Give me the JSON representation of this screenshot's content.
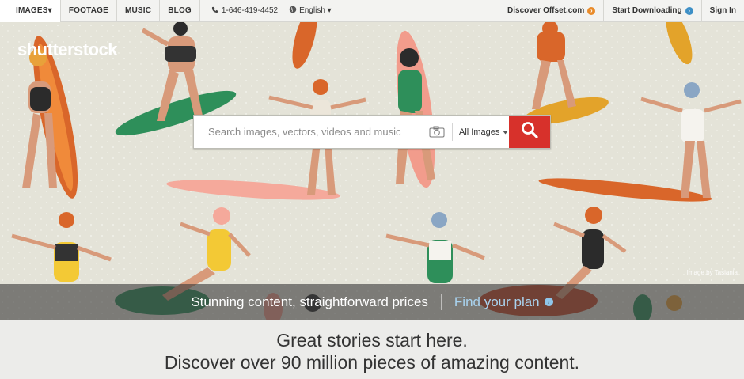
{
  "nav": {
    "tabs": [
      {
        "label": "IMAGES▾"
      },
      {
        "label": "FOOTAGE"
      },
      {
        "label": "MUSIC"
      },
      {
        "label": "BLOG"
      }
    ],
    "phone": "1-646-419-4452",
    "language": "English ▾",
    "right": {
      "offset": "Discover Offset.com",
      "start": "Start Downloading",
      "signin": "Sign In"
    }
  },
  "hero": {
    "logo": "shutterstock",
    "credit": "Image by Tasiania",
    "search": {
      "placeholder": "Search images, vectors, videos and music",
      "filter": "All Images"
    },
    "banner": {
      "text": "Stunning content, straightforward prices",
      "link": "Find your plan"
    }
  },
  "tagline": {
    "line1": "Great stories start here.",
    "line2": "Discover over 90 million pieces of amazing content."
  },
  "colors": {
    "accent_red": "#d7312b",
    "offset_orange": "#e98b2a",
    "link_blue": "#3d8fc6"
  },
  "icons": [
    "phone-icon",
    "globe-icon",
    "camera-icon",
    "search-icon",
    "chevron-right-icon"
  ]
}
